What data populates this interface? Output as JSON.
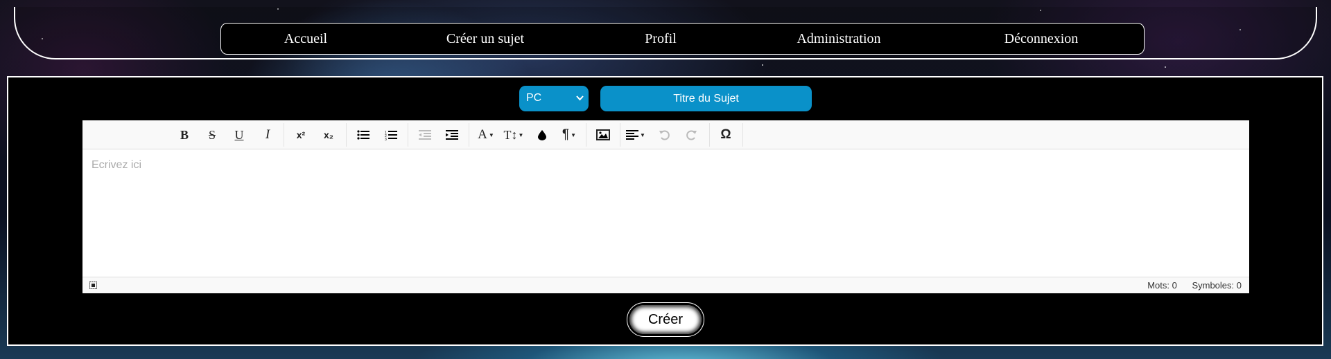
{
  "nav": {
    "items": [
      "Accueil",
      "Créer un sujet",
      "Profil",
      "Administration",
      "Déconnexion"
    ]
  },
  "form": {
    "category_value": "PC",
    "title_placeholder": "Titre du Sujet",
    "editor_placeholder": "Ecrivez ici",
    "words_label": "Mots: 0",
    "symbols_label": "Symboles: 0",
    "submit_label": "Créer"
  },
  "colors": {
    "accent": "#0a91c9",
    "panel_bg": "#000000",
    "border": "#ffffff"
  }
}
